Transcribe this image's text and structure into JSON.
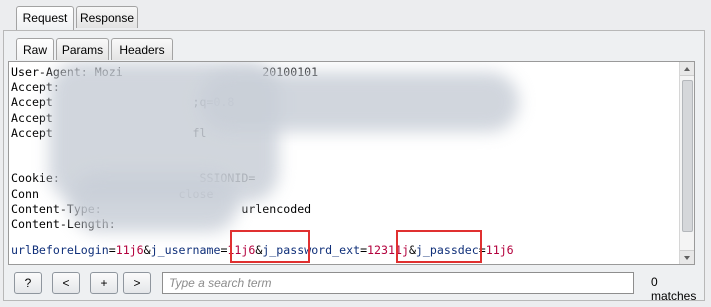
{
  "top_tabs": {
    "request": "Request",
    "response": "Response"
  },
  "sub_tabs": {
    "raw": "Raw",
    "params": "Params",
    "headers": "Headers"
  },
  "header_lines": [
    {
      "key": "User-Agent: Mozi",
      "rest": "20100101"
    },
    {
      "key": "Accept:",
      "rest": ""
    },
    {
      "key": "Accept",
      "rest": ";q=0.8"
    },
    {
      "key": "Accept",
      "rest": ""
    },
    {
      "key": "Accept",
      "rest": "fl"
    },
    {
      "key": "",
      "rest": ""
    },
    {
      "key": "",
      "rest": ""
    },
    {
      "key": "Cookie:",
      "rest": "SSIONID="
    },
    {
      "key": "Conn",
      "rest": "close"
    },
    {
      "key": "Content-Type:",
      "rest": "urlencoded"
    },
    {
      "key": "Content-Length:",
      "rest": ""
    }
  ],
  "body": {
    "k1": "urlBeforeLogin",
    "v1": "11j6",
    "k2": "j_username",
    "v2": "11j6",
    "k3": "j_password_ext",
    "v3": "12311j",
    "k4": "j_passdec",
    "v4": "11j6"
  },
  "buttons": {
    "help": "?",
    "prev": "<",
    "add": "+",
    "next": ">"
  },
  "search": {
    "placeholder": "Type a search term"
  },
  "matches": "0 matches"
}
